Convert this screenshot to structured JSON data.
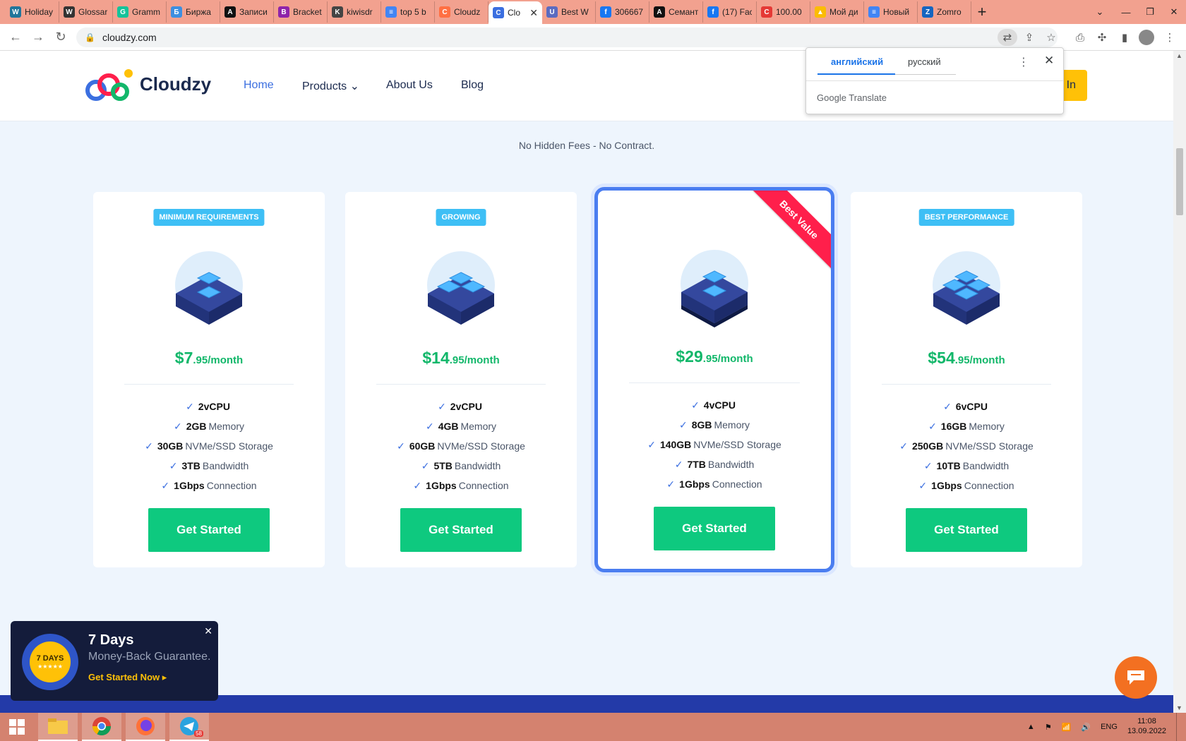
{
  "browser": {
    "tabs": [
      {
        "title": "Holiday",
        "icon": "wordpress-icon",
        "color": "#21759b",
        "glyph": "W"
      },
      {
        "title": "Glossar",
        "icon": "wikipedia-icon",
        "color": "#333333",
        "glyph": "W"
      },
      {
        "title": "Gramm",
        "icon": "grammarly-icon",
        "color": "#15c39a",
        "glyph": "G"
      },
      {
        "title": "Биржа",
        "icon": "exchange-icon",
        "color": "#3d8fe0",
        "glyph": "Б"
      },
      {
        "title": "Записи",
        "icon": "notes-icon",
        "color": "#111111",
        "glyph": "A"
      },
      {
        "title": "Bracket",
        "icon": "brackets-icon",
        "color": "#8e24aa",
        "glyph": "B"
      },
      {
        "title": "kiwisdr",
        "icon": "github-icon",
        "color": "#444444",
        "glyph": "K"
      },
      {
        "title": "top 5 b",
        "icon": "docs-icon",
        "color": "#4285f4",
        "glyph": "≡"
      },
      {
        "title": "Cloudz",
        "icon": "cloudzy-icon",
        "color": "#ff7043",
        "glyph": "C"
      },
      {
        "title": "Clo",
        "icon": "cloudzy-icon",
        "color": "#3b6fe0",
        "glyph": "C",
        "active": true
      },
      {
        "title": "Best W",
        "icon": "website-icon",
        "color": "#5c6bc0",
        "glyph": "U"
      },
      {
        "title": "306667",
        "icon": "facebook-icon",
        "color": "#1877f2",
        "glyph": "f"
      },
      {
        "title": "Семант",
        "icon": "semantic-icon",
        "color": "#111111",
        "glyph": "A"
      },
      {
        "title": "(17) Fac",
        "icon": "facebook-icon",
        "color": "#1877f2",
        "glyph": "f"
      },
      {
        "title": "100.00",
        "icon": "copyright-icon",
        "color": "#e53935",
        "glyph": "C"
      },
      {
        "title": "Мой ди",
        "icon": "google-drive-icon",
        "color": "#fbbc04",
        "glyph": "▲"
      },
      {
        "title": "Новый",
        "icon": "docs-icon",
        "color": "#4285f4",
        "glyph": "≡"
      },
      {
        "title": "Zomro",
        "icon": "zomro-icon",
        "color": "#1565c0",
        "glyph": "Z"
      }
    ],
    "url": "cloudzy.com"
  },
  "translate": {
    "lang_from": "английский",
    "lang_to": "русский",
    "brand": "Google Translate"
  },
  "site": {
    "brand": "Cloudzy",
    "nav": [
      {
        "label": "Home",
        "active": true
      },
      {
        "label": "Products ⌄"
      },
      {
        "label": "About Us"
      },
      {
        "label": "Blog"
      }
    ],
    "signin_label": "In"
  },
  "tagline": "No Hidden Fees - No Contract.",
  "plans": [
    {
      "badge": "MINIMUM REQUIREMENTS",
      "price_whole": "$7",
      "price_cents": ".95/month",
      "tiles": 2,
      "features": [
        {
          "value": "2vCPU",
          "label": ""
        },
        {
          "value": "2GB",
          "label": "Memory"
        },
        {
          "value": "30GB",
          "label": "NVMe/SSD Storage"
        },
        {
          "value": "3TB",
          "label": "Bandwidth"
        },
        {
          "value": "1Gbps",
          "label": "Connection"
        }
      ],
      "button": "Get Started"
    },
    {
      "badge": "GROWING",
      "price_whole": "$14",
      "price_cents": ".95/month",
      "tiles": 3,
      "features": [
        {
          "value": "2vCPU",
          "label": ""
        },
        {
          "value": "4GB",
          "label": "Memory"
        },
        {
          "value": "60GB",
          "label": "NVMe/SSD Storage"
        },
        {
          "value": "5TB",
          "label": "Bandwidth"
        },
        {
          "value": "1Gbps",
          "label": "Connection"
        }
      ],
      "button": "Get Started"
    },
    {
      "ribbon": "Best Value",
      "price_whole": "$29",
      "price_cents": ".95/month",
      "tiles": 2,
      "features": [
        {
          "value": "4vCPU",
          "label": ""
        },
        {
          "value": "8GB",
          "label": "Memory"
        },
        {
          "value": "140GB",
          "label": "NVMe/SSD Storage"
        },
        {
          "value": "7TB",
          "label": "Bandwidth"
        },
        {
          "value": "1Gbps",
          "label": "Connection"
        }
      ],
      "button": "Get Started"
    },
    {
      "badge": "BEST PERFORMANCE",
      "price_whole": "$54",
      "price_cents": ".95/month",
      "tiles": 4,
      "features": [
        {
          "value": "6vCPU",
          "label": ""
        },
        {
          "value": "16GB",
          "label": "Memory"
        },
        {
          "value": "250GB",
          "label": "NVMe/SSD Storage"
        },
        {
          "value": "10TB",
          "label": "Bandwidth"
        },
        {
          "value": "1Gbps",
          "label": "Connection"
        }
      ],
      "button": "Get Started"
    }
  ],
  "guarantee": {
    "seal_top": "7 DAYS",
    "seal_stars": "★★★★★",
    "title": "7 Days",
    "subtitle": "Money-Back Guarantee.",
    "link": "Get Started Now ▸"
  },
  "taskbar": {
    "language": "ENG",
    "time": "11:08",
    "date": "13.09.2022",
    "telegram_badge": "58"
  },
  "colors": {
    "accent": "#3b6fe0",
    "price": "#12b76a",
    "cta": "#0ec97f",
    "badge": "#3ebff5",
    "ribbon": "#ff1f4b"
  }
}
